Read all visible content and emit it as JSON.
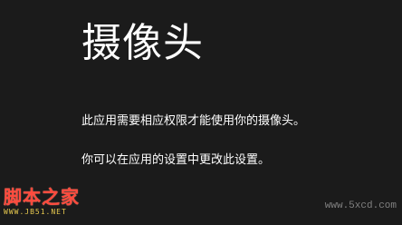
{
  "page": {
    "title": "摄像头",
    "message_line_1": "此应用需要相应权限才能使用你的摄像头。",
    "message_line_2": "你可以在应用的设置中更改此设置。"
  },
  "watermarks": {
    "left_logo_text": "脚本之家",
    "left_logo_url": "WWW.JB51.NET",
    "right_text": "www.5xcd.com"
  }
}
